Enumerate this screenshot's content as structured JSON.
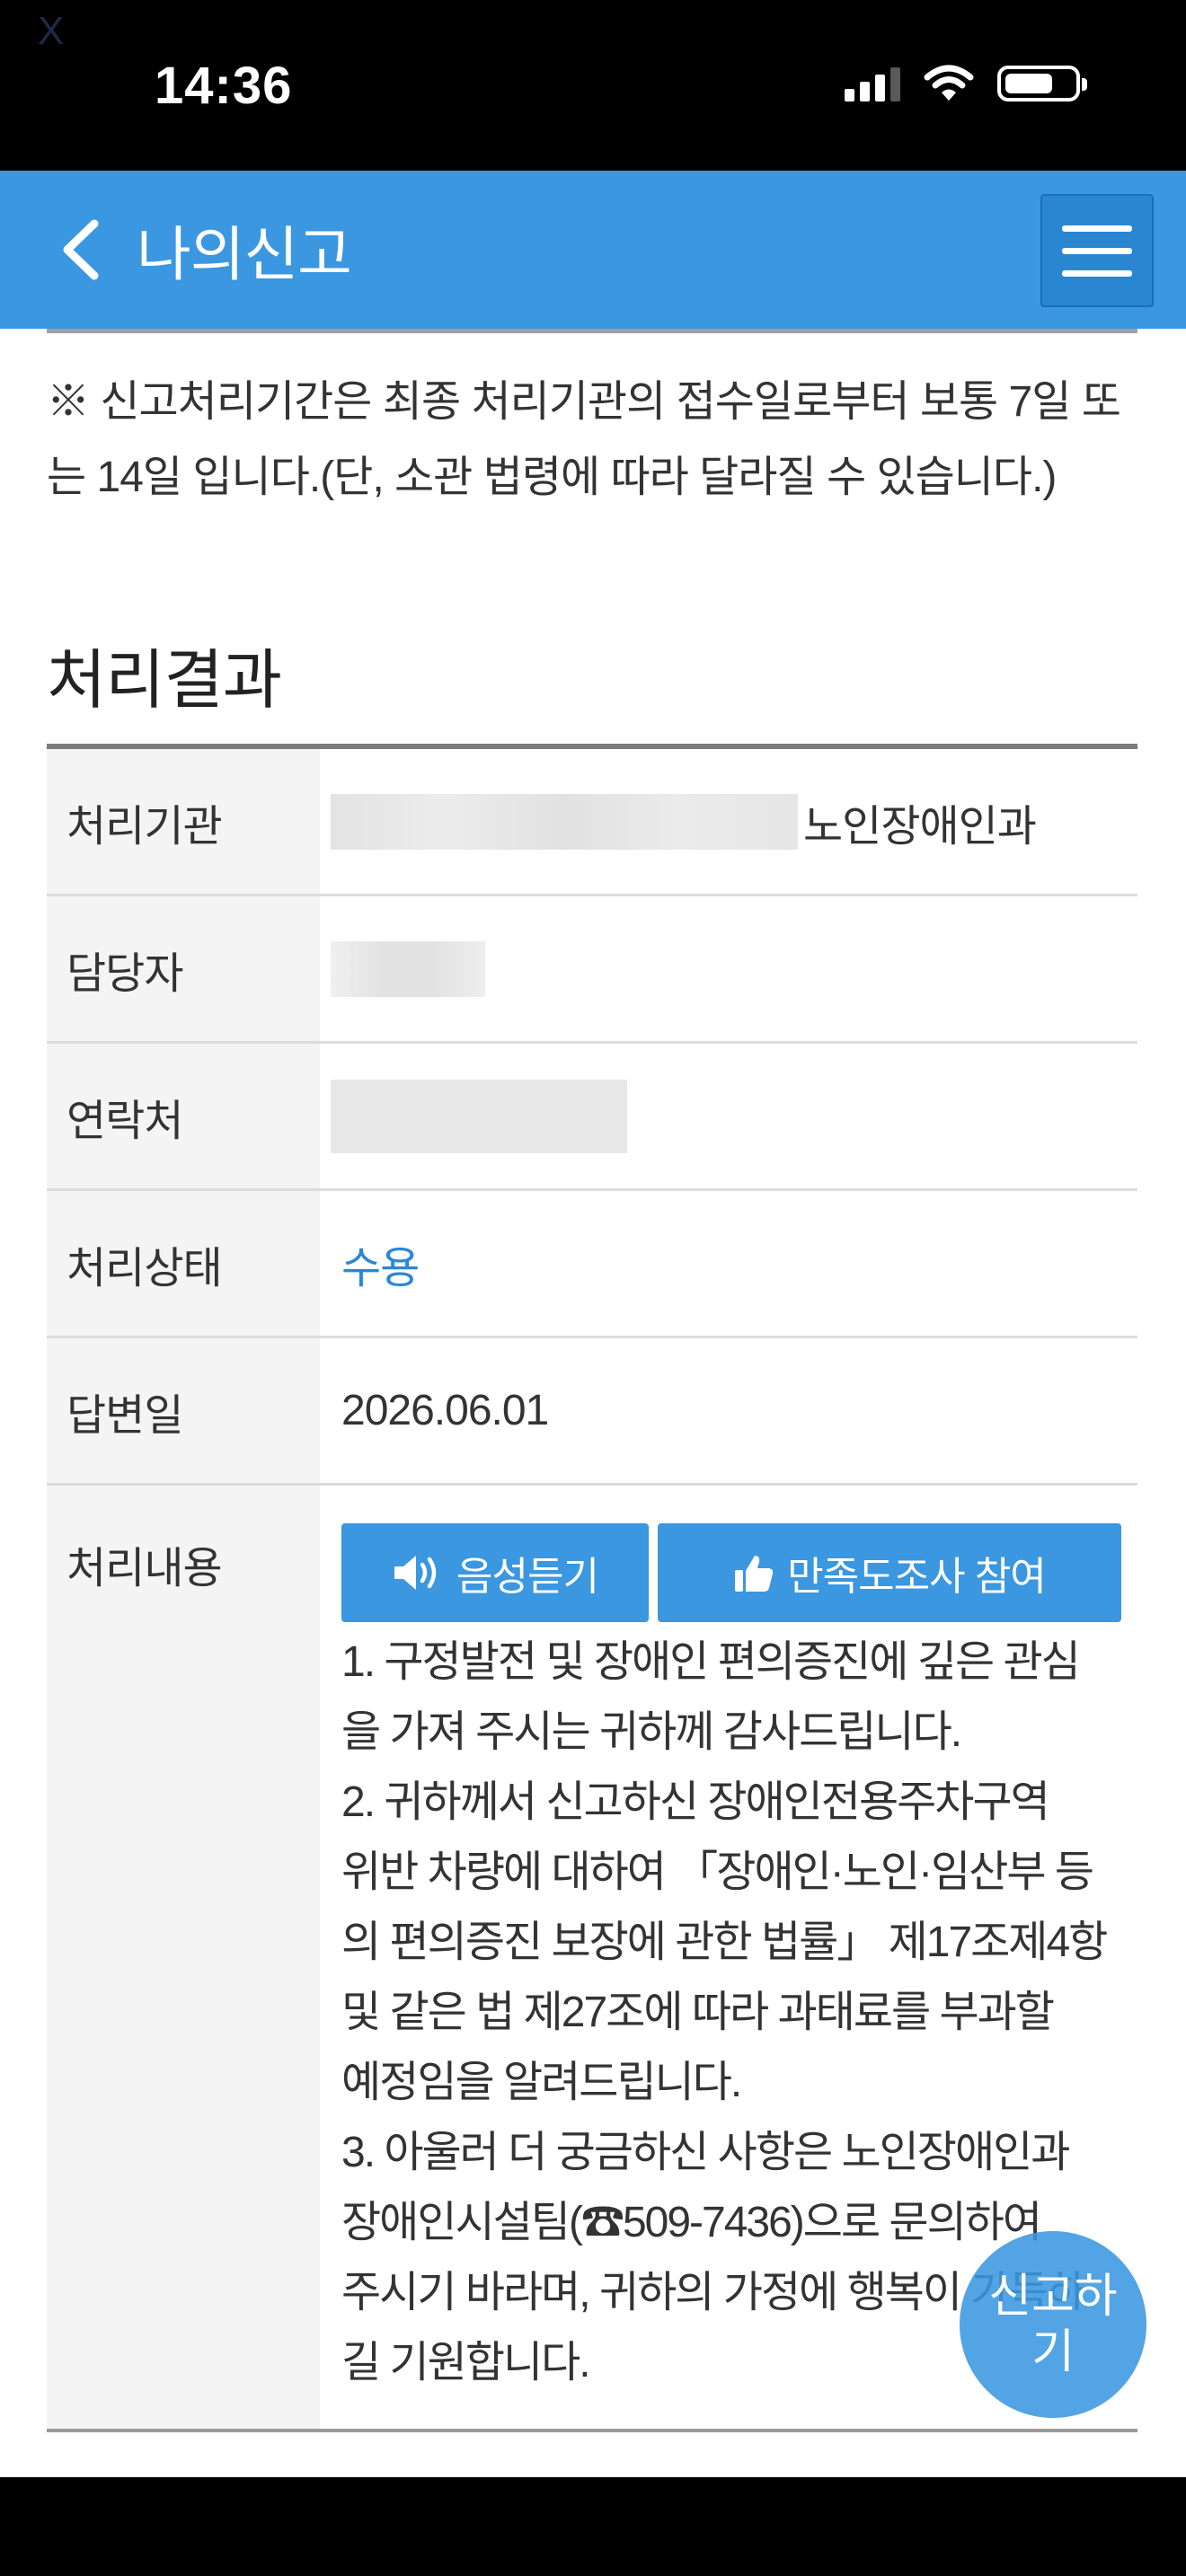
{
  "status_bar": {
    "indicator": "X",
    "time": "14:36"
  },
  "nav": {
    "title": "나의신고",
    "icons": {
      "back": "chevron-left-icon",
      "menu": "hamburger-menu-icon"
    }
  },
  "notice": "※ 신고처리기간은 최종 처리기관의 접수일로부터 보통 7일 또는 14일 입니다.(단, 소관 법령에 따라 달라질 수 있습니다.)",
  "section_title": "처리결과",
  "table": {
    "agency": {
      "label": "처리기관",
      "value_suffix": "노인장애인과"
    },
    "officer": {
      "label": "담당자"
    },
    "contact": {
      "label": "연락처"
    },
    "status": {
      "label": "처리상태",
      "value": "수용",
      "color": "#2a86d8"
    },
    "answer_date": {
      "label": "답변일",
      "value": "2026.06.01"
    },
    "content": {
      "label": "처리내용",
      "voice_button": "음성듣기",
      "survey_button": "만족도조사 참여",
      "text": "1. 구정발전 및 장애인 편의증진에 깊은 관심\n을 가져 주시는 귀하께 감사드립니다.\n2. 귀하께서 신고하신 장애인전용주차구역\n위반 차량에 대하여 「장애인·노인·임산부 등\n의 편의증진 보장에 관한 법률」 제17조제4항\n및 같은 법 제27조에 따라 과태료를 부과할\n예정임을 알려드립니다.\n3. 아울러 더 궁금하신 사항은 노인장애인과\n장애인시설팀(☎509-7436)으로 문의하여\n주시기 바라며, 귀하의 가정에 행복이 가득하\n길 기원합니다."
    }
  },
  "float_button": "신고하\n기",
  "colors": {
    "primary": "#3a97e0",
    "accent_text": "#2a86d8"
  }
}
